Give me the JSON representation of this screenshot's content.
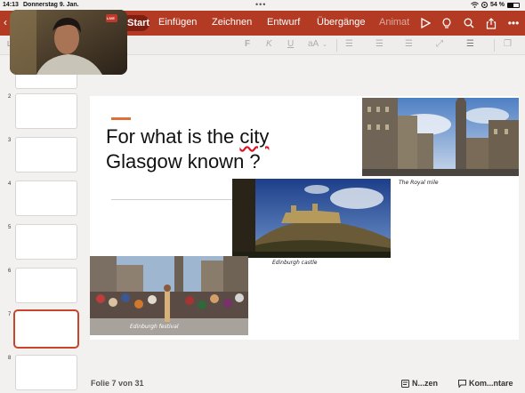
{
  "status": {
    "time": "14:13",
    "date": "Donnerstag 9. Jan.",
    "battery": "54 %",
    "battery_level": 0.54
  },
  "ribbon": {
    "tabs": [
      {
        "label": "Start",
        "active": true
      },
      {
        "label": "Einfügen"
      },
      {
        "label": "Zeichnen"
      },
      {
        "label": "Entwurf"
      },
      {
        "label": "Übergänge"
      },
      {
        "label": "Animat"
      }
    ],
    "icons": [
      "play-icon",
      "lightbulb-icon",
      "search-icon",
      "share-icon",
      "more-icon"
    ]
  },
  "toolbar": {
    "bold": "F",
    "italic": "K",
    "underline": "U",
    "font_size": "aA"
  },
  "thumbnails": [
    {
      "num": "",
      "selected": false
    },
    {
      "num": "2",
      "selected": false
    },
    {
      "num": "3",
      "selected": false
    },
    {
      "num": "4",
      "selected": false
    },
    {
      "num": "5",
      "selected": false
    },
    {
      "num": "6",
      "selected": false
    },
    {
      "num": "7",
      "selected": true
    },
    {
      "num": "8",
      "selected": false
    }
  ],
  "slide": {
    "title": "For what is the city\nGlasgow known  ?",
    "captions": {
      "royal_mile": "The Royal mile",
      "castle": "Edinburgh castle",
      "festival": "Edinburgh festival"
    }
  },
  "bottom": {
    "slide_count": "Folie 7 von 31",
    "notes": "N...zen",
    "comments": "Kom...ntare"
  },
  "video": {
    "badge": "LIVE"
  },
  "colors": {
    "ribbon": "#b33b24",
    "accent": "#c8442a"
  }
}
